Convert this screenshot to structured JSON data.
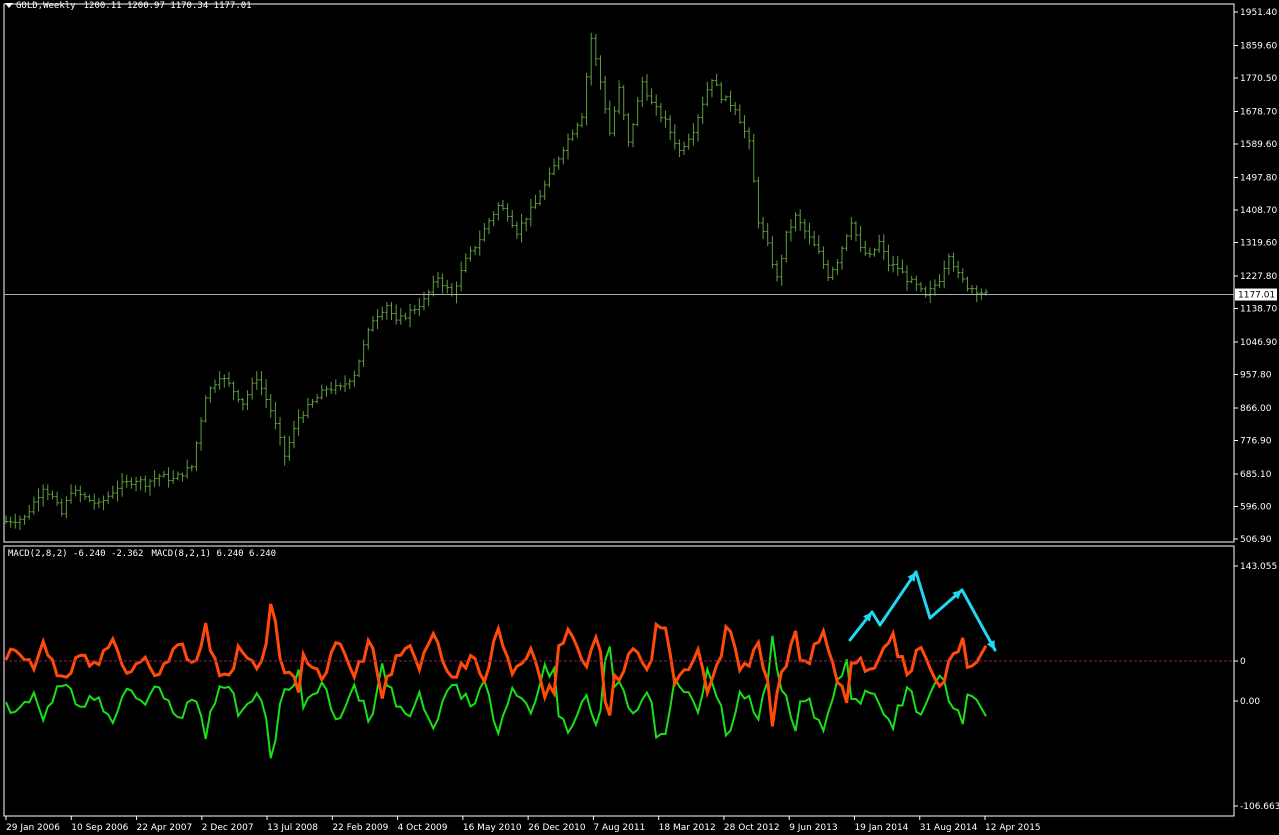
{
  "header": {
    "symbol": "GOLD,Weekly",
    "ohlc": "1200.11 1200.97 1170.34 1177.01"
  },
  "indicator_header": {
    "macd1": "MACD(2,8,2) -6.240 -2.362",
    "macd2": "MACD(8,2,1) 6.240 6.240"
  },
  "colors": {
    "background": "#000000",
    "price_bars": "#5f9e3f",
    "macd_green": "#19e019",
    "macd_orange": "#ff4a0a",
    "annotation_arrows": "#22d8f0",
    "grid_lines": "#ffffff",
    "zero_line": "#8b2252"
  },
  "chart_data": [
    {
      "type": "bar",
      "title": "GOLD,Weekly",
      "y_axis_ticks": [
        "1951.40",
        "1859.60",
        "1770.50",
        "1678.70",
        "1589.60",
        "1497.80",
        "1408.70",
        "1319.60",
        "1227.80",
        "1138.70",
        "1046.90",
        "957.80",
        "866.00",
        "776.90",
        "685.10",
        "596.00",
        "506.90"
      ],
      "y_range": [
        506.9,
        1951.4
      ],
      "current_price_label": "1177.01",
      "current_price": 1177.01,
      "x_tick_labels": [
        "29 Jan 2006",
        "10 Sep 2006",
        "22 Apr 2007",
        "2 Dec 2007",
        "13 Jul 2008",
        "22 Feb 2009",
        "4 Oct 2009",
        "16 May 2010",
        "26 Dec 2010",
        "7 Aug 2011",
        "18 Mar 2012",
        "28 Oct 2012",
        "9 Jun 2013",
        "19 Jan 2014",
        "31 Aug 2014",
        "12 Apr 2015"
      ],
      "price_path": [
        [
          0,
          555
        ],
        [
          4,
          565
        ],
        [
          8,
          650
        ],
        [
          10,
          620
        ],
        [
          12,
          575
        ],
        [
          14,
          640
        ],
        [
          17,
          620
        ],
        [
          20,
          600
        ],
        [
          24,
          650
        ],
        [
          28,
          670
        ],
        [
          30,
          660
        ],
        [
          33,
          680
        ],
        [
          36,
          670
        ],
        [
          40,
          705
        ],
        [
          43,
          900
        ],
        [
          46,
          955
        ],
        [
          48,
          930
        ],
        [
          51,
          880
        ],
        [
          54,
          950
        ],
        [
          57,
          860
        ],
        [
          60,
          735
        ],
        [
          63,
          840
        ],
        [
          66,
          880
        ],
        [
          69,
          920
        ],
        [
          72,
          920
        ],
        [
          75,
          960
        ],
        [
          79,
          1110
        ],
        [
          82,
          1150
        ],
        [
          84,
          1100
        ],
        [
          87,
          1130
        ],
        [
          90,
          1160
        ],
        [
          93,
          1225
        ],
        [
          96,
          1175
        ],
        [
          99,
          1270
        ],
        [
          102,
          1330
        ],
        [
          104,
          1380
        ],
        [
          106,
          1420
        ],
        [
          108,
          1400
        ],
        [
          110,
          1350
        ],
        [
          112,
          1390
        ],
        [
          114,
          1425
        ],
        [
          117,
          1500
        ],
        [
          120,
          1580
        ],
        [
          124,
          1670
        ],
        [
          126,
          1880
        ],
        [
          128,
          1760
        ],
        [
          130,
          1620
        ],
        [
          132,
          1740
        ],
        [
          134,
          1590
        ],
        [
          137,
          1760
        ],
        [
          139,
          1700
        ],
        [
          142,
          1650
        ],
        [
          145,
          1570
        ],
        [
          148,
          1630
        ],
        [
          151,
          1740
        ],
        [
          152,
          1770
        ],
        [
          154,
          1720
        ],
        [
          157,
          1690
        ],
        [
          160,
          1590
        ],
        [
          162,
          1380
        ],
        [
          164,
          1310
        ],
        [
          166,
          1220
        ],
        [
          168,
          1340
        ],
        [
          170,
          1390
        ],
        [
          173,
          1330
        ],
        [
          175,
          1290
        ],
        [
          177,
          1230
        ],
        [
          179,
          1270
        ],
        [
          182,
          1380
        ],
        [
          184,
          1300
        ],
        [
          186,
          1280
        ],
        [
          188,
          1320
        ],
        [
          190,
          1260
        ],
        [
          192,
          1250
        ],
        [
          194,
          1220
        ],
        [
          196,
          1200
        ],
        [
          198,
          1170
        ],
        [
          201,
          1220
        ],
        [
          203,
          1290
        ],
        [
          205,
          1230
        ],
        [
          207,
          1200
        ],
        [
          209,
          1190
        ],
        [
          211,
          1177
        ]
      ]
    },
    {
      "type": "line",
      "title": "MACD",
      "y_axis_ticks": [
        "143.055",
        "0",
        "0.00",
        "-106.663"
      ],
      "y_range": [
        -106.663,
        143.055
      ],
      "series": [
        {
          "name": "MACD(2,8,2)"
        },
        {
          "name": "MACD(8,2,1)"
        }
      ],
      "annotations": "hand-drawn cyan zigzag arrows over the 2014-2015 section"
    }
  ]
}
